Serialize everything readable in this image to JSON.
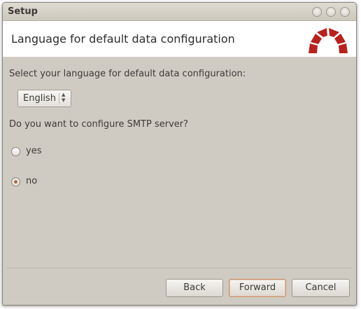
{
  "window": {
    "title": "Setup"
  },
  "banner": {
    "title": "Language for default data configuration",
    "logo_icon": "redmine-logo-icon"
  },
  "language": {
    "label": "Select your language for default data configuration:",
    "selected": "English"
  },
  "smtp": {
    "question": "Do you want to configure SMTP server?",
    "options": [
      {
        "label": "yes",
        "checked": false
      },
      {
        "label": "no",
        "checked": true
      }
    ]
  },
  "buttons": {
    "back": "Back",
    "forward": "Forward",
    "cancel": "Cancel"
  },
  "colors": {
    "accent": "#b5231f",
    "radio_checked": "#a26b4c"
  }
}
